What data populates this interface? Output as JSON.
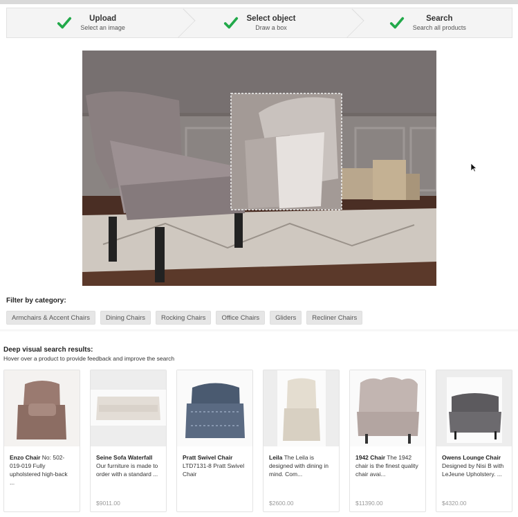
{
  "steps": [
    {
      "title": "Upload",
      "desc": "Select an image",
      "icon": "check-icon"
    },
    {
      "title": "Select object",
      "desc": "Draw a box",
      "icon": "check-icon"
    },
    {
      "title": "Search",
      "desc": "Search all products",
      "icon": "check-icon"
    }
  ],
  "colors": {
    "check": "#22a94a",
    "chip_bg": "#e6e6e6"
  },
  "filter": {
    "label": "Filter by category:",
    "chips": [
      "Armchairs & Accent Chairs",
      "Dining Chairs",
      "Rocking Chairs",
      "Office Chairs",
      "Gliders",
      "Recliner Chairs"
    ]
  },
  "results": {
    "title": "Deep visual search results:",
    "subtitle": "Hover over a product to provide feedback and improve the search",
    "items": [
      {
        "name": "Enzo Chair",
        "desc": " No: 502-019-019 Fully upholstered high-back ...",
        "price": ""
      },
      {
        "name": "Seine Sofa Waterfall",
        "desc": " Our furniture is made to order with a standard ...",
        "price": "$9011.00"
      },
      {
        "name": "Pratt Swivel Chair",
        "desc": " LTD7131-8 Pratt Swivel Chair",
        "price": ""
      },
      {
        "name": "Leila",
        "desc": " The Leila is designed with dining in mind. Com...",
        "price": "$2600.00"
      },
      {
        "name": "1942 Chair",
        "desc": " The 1942 chair is the finest quality chair avai...",
        "price": "$11390.00"
      },
      {
        "name": "Owens Lounge Chair",
        "desc": " Designed by Nisi B with LeJeune Upholstery. ...",
        "price": "$4320.00"
      }
    ]
  }
}
